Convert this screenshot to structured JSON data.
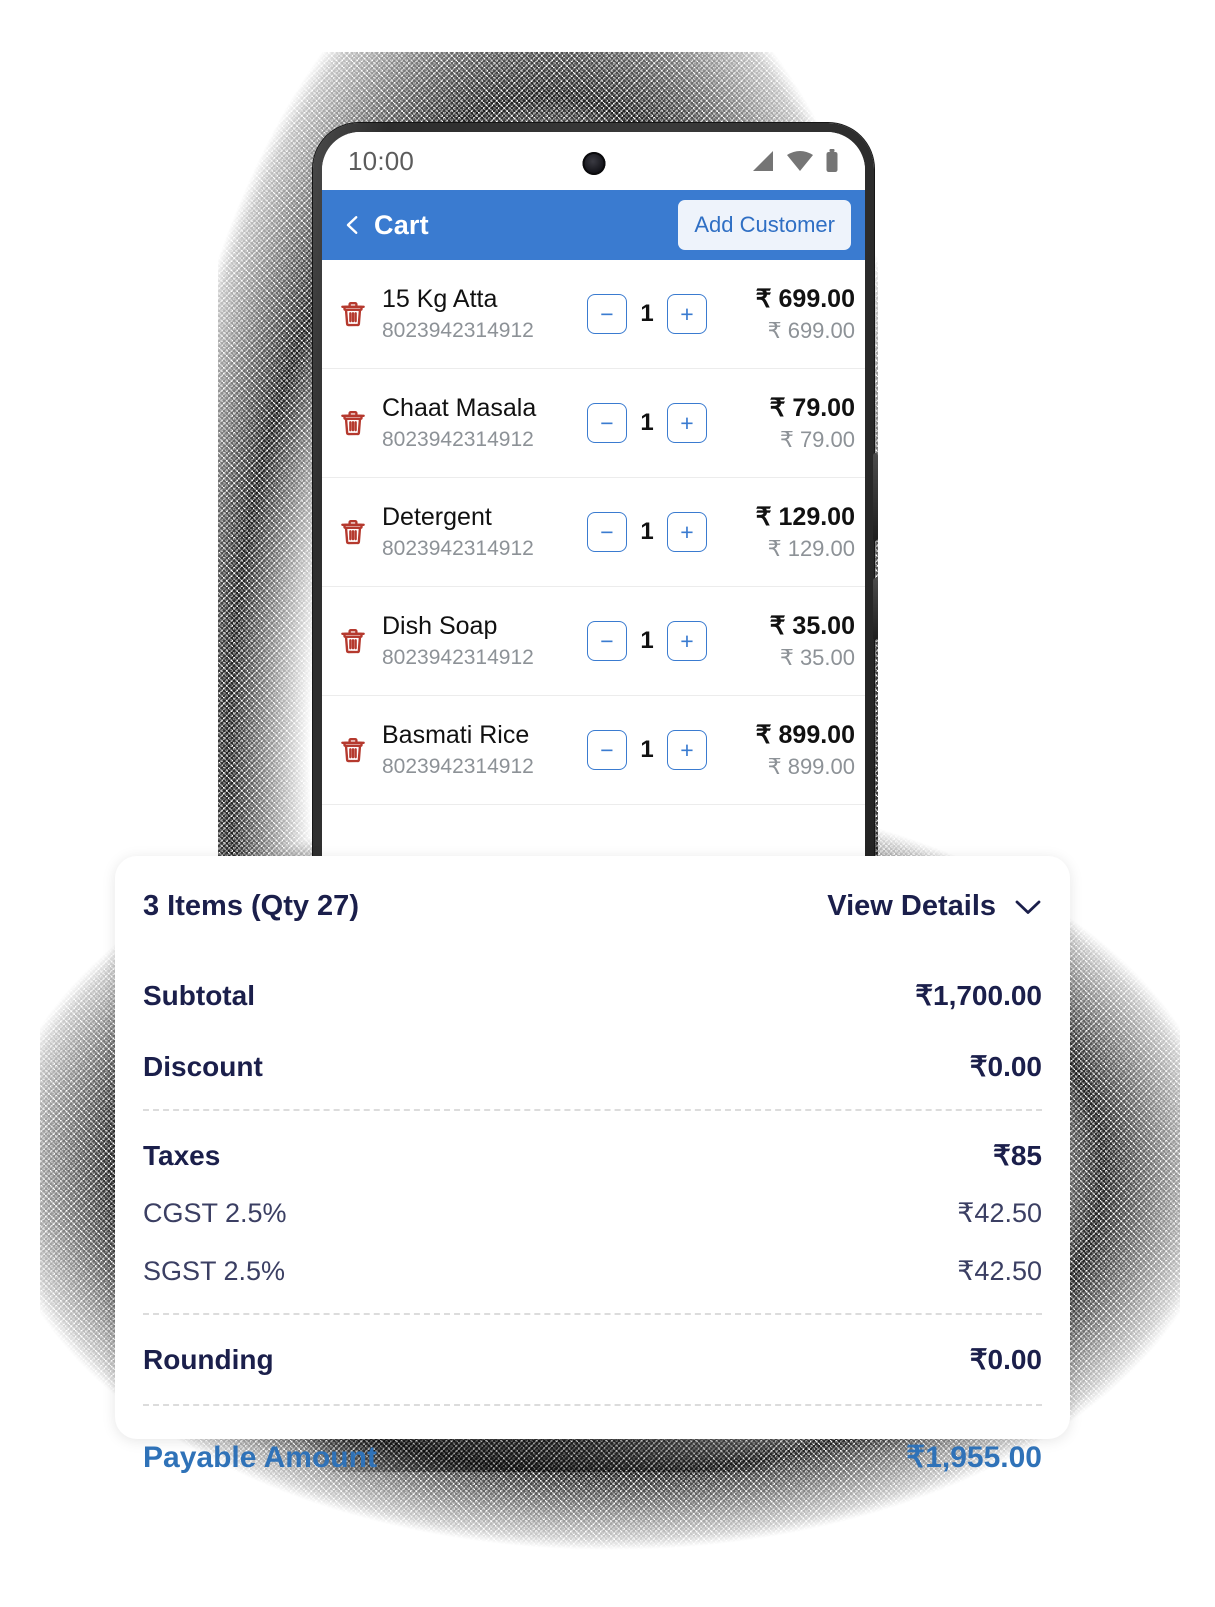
{
  "status_bar": {
    "time": "10:00",
    "icons": [
      "signal-icon",
      "wifi-icon",
      "battery-icon"
    ]
  },
  "app_bar": {
    "back_icon": "chevron-left-icon",
    "title": "Cart",
    "add_customer_label": "Add Customer"
  },
  "cart": {
    "delete_icon": "trash-icon",
    "decrement_label": "−",
    "increment_label": "+",
    "items": [
      {
        "name": "15 Kg Atta",
        "code": "8023942314912",
        "qty": "1",
        "price": "₹ 699.00",
        "unit_price": "₹ 699.00"
      },
      {
        "name": "Chaat Masala",
        "code": "8023942314912",
        "qty": "1",
        "price": "₹ 79.00",
        "unit_price": "₹ 79.00"
      },
      {
        "name": "Detergent",
        "code": "8023942314912",
        "qty": "1",
        "price": "₹ 129.00",
        "unit_price": "₹ 129.00"
      },
      {
        "name": "Dish Soap",
        "code": "8023942314912",
        "qty": "1",
        "price": "₹ 35.00",
        "unit_price": "₹ 35.00"
      },
      {
        "name": "Basmati Rice",
        "code": "8023942314912",
        "qty": "1",
        "price": "₹ 899.00",
        "unit_price": "₹ 899.00"
      }
    ]
  },
  "summary": {
    "items_count": "3 Items (Qty 27)",
    "view_details_label": "View Details",
    "chevron_icon": "chevron-down-icon",
    "subtotal_label": "Subtotal",
    "subtotal_value": "₹1,700.00",
    "discount_label": "Discount",
    "discount_value": "₹0.00",
    "taxes_label": "Taxes",
    "taxes_value": "₹85",
    "cgst_label": "CGST 2.5%",
    "cgst_value": "₹42.50",
    "sgst_label": "SGST 2.5%",
    "sgst_value": "₹42.50",
    "rounding_label": "Rounding",
    "rounding_value": "₹0.00",
    "payable_label": "Payable Amount",
    "payable_value": "₹1,955.00"
  },
  "colors": {
    "accent_blue": "#3a7bd0",
    "payable_blue": "#2f72b8",
    "navy": "#1b1f4b",
    "delete_red": "#b5392e",
    "muted_gray": "#8d9297"
  }
}
